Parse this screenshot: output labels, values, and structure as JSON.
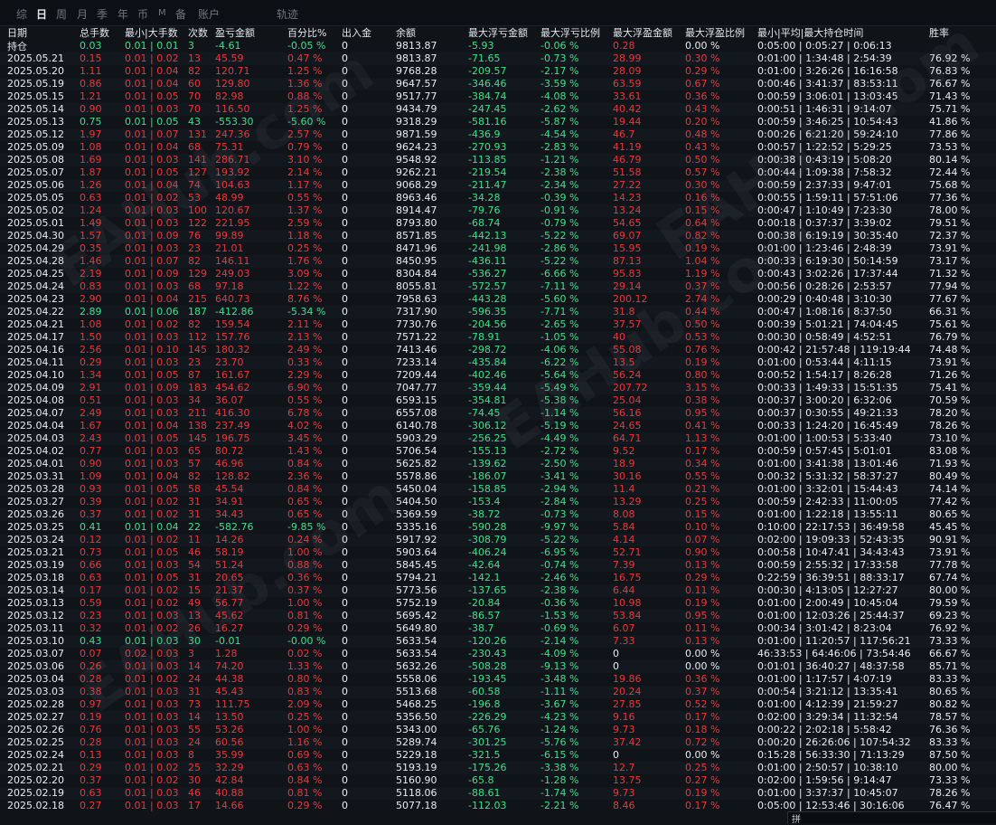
{
  "tabs": [
    {
      "label": "综",
      "active": false
    },
    {
      "label": "日",
      "active": true
    },
    {
      "label": "周",
      "active": false
    },
    {
      "label": "月",
      "active": false
    },
    {
      "label": "季",
      "active": false
    },
    {
      "label": "年",
      "active": false
    },
    {
      "label": "币",
      "active": false
    },
    {
      "label": "M",
      "active": false
    },
    {
      "label": "备",
      "active": false
    },
    {
      "label": "账户",
      "active": false
    },
    {
      "label": "轨迹",
      "active": false
    }
  ],
  "watermark": "EAHub.com",
  "status_glyph": "拼",
  "colors": {
    "positive": "#3ee08a",
    "negative": "#e8383d",
    "neutral": "#e8ebef",
    "background": "#101419"
  },
  "headers": [
    "日期",
    "总手数",
    "最小|大手数",
    "次数",
    "盈亏金额",
    "百分比%",
    "出入金",
    "余额",
    "最大浮亏金额",
    "最大浮亏比例",
    "最大浮盈金额",
    "最大浮盈比例",
    "最小|平均|最大持仓时间",
    "胜率"
  ],
  "header_sub": "持仓",
  "rows": [
    [
      "",
      "0.03",
      "0.01 | 0.01",
      "3",
      "-4.61",
      "-0.05 %",
      "0",
      "9813.87",
      "-5.93",
      "-0.06 %",
      "0.28",
      "0.00 %",
      "0:05:00 | 0:05:27 | 0:06:13",
      ""
    ],
    [
      "2025.05.21",
      "0.15",
      "0.01 | 0.02",
      "13",
      "45.59",
      "0.47 %",
      "0",
      "9813.87",
      "-71.65",
      "-0.73 %",
      "28.99",
      "0.30 %",
      "0:01:00 | 1:34:48 | 2:54:39",
      "76.92 %"
    ],
    [
      "2025.05.20",
      "1.11",
      "0.01 | 0.04",
      "82",
      "120.71",
      "1.25 %",
      "0",
      "9768.28",
      "-209.57",
      "-2.17 %",
      "28.09",
      "0.29 %",
      "0:01:00 | 3:26:26 | 16:16:58",
      "76.83 %"
    ],
    [
      "2025.05.19",
      "0.86",
      "0.01 | 0.04",
      "60",
      "129.80",
      "1.36 %",
      "0",
      "9647.57",
      "-346.46",
      "-3.59 %",
      "63.59",
      "0.67 %",
      "0:00:46 | 3:41:37 | 83:53:11",
      "76.67 %"
    ],
    [
      "2025.05.15",
      "1.21",
      "0.01 | 0.05",
      "70",
      "82.98",
      "0.88 %",
      "0",
      "9517.77",
      "-384.74",
      "-4.08 %",
      "33.61",
      "0.36 %",
      "0:00:59 | 3:06:01 | 13:03:45",
      "71.43 %"
    ],
    [
      "2025.05.14",
      "0.90",
      "0.01 | 0.03",
      "70",
      "116.50",
      "1.25 %",
      "0",
      "9434.79",
      "-247.45",
      "-2.62 %",
      "40.42",
      "0.43 %",
      "0:00:51 | 1:46:31 | 9:14:07",
      "75.71 %"
    ],
    [
      "2025.05.13",
      "0.75",
      "0.01 | 0.05",
      "43",
      "-553.30",
      "-5.60 %",
      "0",
      "9318.29",
      "-581.16",
      "-5.87 %",
      "19.44",
      "0.20 %",
      "0:00:59 | 3:46:25 | 10:54:43",
      "41.86 %"
    ],
    [
      "2025.05.12",
      "1.97",
      "0.01 | 0.07",
      "131",
      "247.36",
      "2.57 %",
      "0",
      "9871.59",
      "-436.9",
      "-4.54 %",
      "46.7",
      "0.48 %",
      "0:00:26 | 6:21:20 | 59:24:10",
      "77.86 %"
    ],
    [
      "2025.05.09",
      "1.08",
      "0.01 | 0.04",
      "68",
      "75.31",
      "0.79 %",
      "0",
      "9624.23",
      "-270.93",
      "-2.83 %",
      "41.19",
      "0.43 %",
      "0:00:57 | 1:22:52 | 5:29:25",
      "73.53 %"
    ],
    [
      "2025.05.08",
      "1.69",
      "0.01 | 0.03",
      "141",
      "286.71",
      "3.10 %",
      "0",
      "9548.92",
      "-113.85",
      "-1.21 %",
      "46.79",
      "0.50 %",
      "0:00:38 | 0:43:19 | 5:08:20",
      "80.14 %"
    ],
    [
      "2025.05.07",
      "1.87",
      "0.01 | 0.05",
      "127",
      "193.92",
      "2.14 %",
      "0",
      "9262.21",
      "-219.54",
      "-2.38 %",
      "51.58",
      "0.57 %",
      "0:00:44 | 1:09:38 | 7:58:32",
      "72.44 %"
    ],
    [
      "2025.05.06",
      "1.26",
      "0.01 | 0.04",
      "74",
      "104.63",
      "1.17 %",
      "0",
      "9068.29",
      "-211.47",
      "-2.34 %",
      "27.22",
      "0.30 %",
      "0:00:59 | 2:37:33 | 9:47:01",
      "75.68 %"
    ],
    [
      "2025.05.05",
      "0.63",
      "0.01 | 0.02",
      "53",
      "48.99",
      "0.55 %",
      "0",
      "8963.46",
      "-34.28",
      "-0.39 %",
      "14.23",
      "0.16 %",
      "0:00:55 | 1:59:11 | 57:51:06",
      "77.36 %"
    ],
    [
      "2025.05.02",
      "1.24",
      "0.01 | 0.03",
      "100",
      "120.67",
      "1.37 %",
      "0",
      "8914.47",
      "-79.76",
      "-0.91 %",
      "13.24",
      "0.15 %",
      "0:00:47 | 1:10:49 | 7:23:30",
      "78.00 %"
    ],
    [
      "2025.05.01",
      "1.49",
      "0.01 | 0.03",
      "122",
      "221.95",
      "2.59 %",
      "0",
      "8793.80",
      "-68.74",
      "-0.79 %",
      "54.65",
      "0.64 %",
      "0:00:18 | 0:37:37 | 3:39:02",
      "79.51 %"
    ],
    [
      "2025.04.30",
      "1.57",
      "0.01 | 0.09",
      "76",
      "99.89",
      "1.18 %",
      "0",
      "8571.85",
      "-442.13",
      "-5.22 %",
      "69.07",
      "0.82 %",
      "0:00:38 | 6:19:19 | 30:35:40",
      "72.37 %"
    ],
    [
      "2025.04.29",
      "0.35",
      "0.01 | 0.03",
      "23",
      "21.01",
      "0.25 %",
      "0",
      "8471.96",
      "-241.98",
      "-2.86 %",
      "15.95",
      "0.19 %",
      "0:01:00 | 1:23:46 | 2:48:39",
      "73.91 %"
    ],
    [
      "2025.04.28",
      "1.46",
      "0.01 | 0.07",
      "82",
      "146.11",
      "1.76 %",
      "0",
      "8450.95",
      "-436.11",
      "-5.22 %",
      "87.13",
      "1.04 %",
      "0:00:33 | 6:19:30 | 50:14:59",
      "73.17 %"
    ],
    [
      "2025.04.25",
      "2.19",
      "0.01 | 0.09",
      "129",
      "249.03",
      "3.09 %",
      "0",
      "8304.84",
      "-536.27",
      "-6.66 %",
      "95.83",
      "1.19 %",
      "0:00:43 | 3:02:26 | 17:37:44",
      "71.32 %"
    ],
    [
      "2025.04.24",
      "0.83",
      "0.01 | 0.03",
      "68",
      "97.18",
      "1.22 %",
      "0",
      "8055.81",
      "-572.57",
      "-7.11 %",
      "29.14",
      "0.37 %",
      "0:00:56 | 0:28:26 | 2:53:57",
      "77.94 %"
    ],
    [
      "2025.04.23",
      "2.90",
      "0.01 | 0.04",
      "215",
      "640.73",
      "8.76 %",
      "0",
      "7958.63",
      "-443.28",
      "-5.60 %",
      "200.12",
      "2.74 %",
      "0:00:29 | 0:40:48 | 3:10:30",
      "77.67 %"
    ],
    [
      "2025.04.22",
      "2.89",
      "0.01 | 0.06",
      "187",
      "-412.86",
      "-5.34 %",
      "0",
      "7317.90",
      "-596.35",
      "-7.71 %",
      "31.8",
      "0.44 %",
      "0:00:47 | 1:08:16 | 8:37:50",
      "66.31 %"
    ],
    [
      "2025.04.21",
      "1.08",
      "0.01 | 0.02",
      "82",
      "159.54",
      "2.11 %",
      "0",
      "7730.76",
      "-204.56",
      "-2.65 %",
      "37.57",
      "0.50 %",
      "0:00:39 | 5:01:21 | 74:04:45",
      "75.61 %"
    ],
    [
      "2025.04.17",
      "1.50",
      "0.01 | 0.03",
      "112",
      "157.76",
      "2.13 %",
      "0",
      "7571.22",
      "-78.91",
      "-1.05 %",
      "40",
      "0.53 %",
      "0:00:30 | 0:58:49 | 4:52:51",
      "76.79 %"
    ],
    [
      "2025.04.16",
      "2.56",
      "0.01 | 0.10",
      "145",
      "180.32",
      "2.49 %",
      "0",
      "7413.46",
      "-298.72",
      "-4.06 %",
      "55.08",
      "0.76 %",
      "0:00:42 | 21:57:48 | 119:19:44",
      "74.48 %"
    ],
    [
      "2025.04.11",
      "0.29",
      "0.01 | 0.03",
      "23",
      "23.70",
      "0.33 %",
      "0",
      "7233.14",
      "-435.84",
      "-6.22 %",
      "13.5",
      "0.19 %",
      "0:01:00 | 0:53:44 | 4:11:15",
      "73.91 %"
    ],
    [
      "2025.04.10",
      "1.34",
      "0.01 | 0.05",
      "87",
      "161.67",
      "2.29 %",
      "0",
      "7209.44",
      "-402.46",
      "-5.64 %",
      "56.24",
      "0.80 %",
      "0:00:52 | 1:54:17 | 8:26:28",
      "71.26 %"
    ],
    [
      "2025.04.09",
      "2.91",
      "0.01 | 0.09",
      "183",
      "454.62",
      "6.90 %",
      "0",
      "7047.77",
      "-359.44",
      "-5.49 %",
      "207.72",
      "3.15 %",
      "0:00:33 | 1:49:33 | 15:51:35",
      "75.41 %"
    ],
    [
      "2025.04.08",
      "0.51",
      "0.01 | 0.03",
      "34",
      "36.07",
      "0.55 %",
      "0",
      "6593.15",
      "-354.81",
      "-5.38 %",
      "25.04",
      "0.38 %",
      "0:00:37 | 3:00:20 | 6:32:06",
      "70.59 %"
    ],
    [
      "2025.04.07",
      "2.49",
      "0.01 | 0.03",
      "211",
      "416.30",
      "6.78 %",
      "0",
      "6557.08",
      "-74.45",
      "-1.14 %",
      "56.16",
      "0.95 %",
      "0:00:37 | 0:30:55 | 49:21:33",
      "78.20 %"
    ],
    [
      "2025.04.04",
      "1.67",
      "0.01 | 0.04",
      "138",
      "237.49",
      "4.02 %",
      "0",
      "6140.78",
      "-306.12",
      "-5.19 %",
      "24.65",
      "0.41 %",
      "0:00:33 | 1:24:20 | 16:45:49",
      "78.26 %"
    ],
    [
      "2025.04.03",
      "2.43",
      "0.01 | 0.05",
      "145",
      "196.75",
      "3.45 %",
      "0",
      "5903.29",
      "-256.25",
      "-4.49 %",
      "64.71",
      "1.13 %",
      "0:01:00 | 1:00:53 | 5:33:40",
      "73.10 %"
    ],
    [
      "2025.04.02",
      "0.77",
      "0.01 | 0.03",
      "65",
      "80.72",
      "1.43 %",
      "0",
      "5706.54",
      "-155.13",
      "-2.72 %",
      "9.52",
      "0.17 %",
      "0:00:59 | 0:57:45 | 5:01:01",
      "83.08 %"
    ],
    [
      "2025.04.01",
      "0.90",
      "0.01 | 0.03",
      "57",
      "46.96",
      "0.84 %",
      "0",
      "5625.82",
      "-139.62",
      "-2.50 %",
      "18.9",
      "0.34 %",
      "0:01:00 | 3:41:38 | 13:01:46",
      "71.93 %"
    ],
    [
      "2025.03.31",
      "1.09",
      "0.01 | 0.04",
      "82",
      "128.82",
      "2.36 %",
      "0",
      "5578.86",
      "-186.07",
      "-3.41 %",
      "30.16",
      "0.55 %",
      "0:00:32 | 5:31:32 | 58:37:27",
      "80.49 %"
    ],
    [
      "2025.03.28",
      "0.93",
      "0.01 | 0.05",
      "58",
      "45.54",
      "0.84 %",
      "0",
      "5450.04",
      "-158.85",
      "-2.94 %",
      "11.4",
      "0.21 %",
      "0:01:00 | 3:32:01 | 15:44:43",
      "74.14 %"
    ],
    [
      "2025.03.27",
      "0.39",
      "0.01 | 0.02",
      "31",
      "34.91",
      "0.65 %",
      "0",
      "5404.50",
      "-153.4",
      "-2.84 %",
      "13.29",
      "0.25 %",
      "0:00:59 | 2:42:33 | 11:00:05",
      "77.42 %"
    ],
    [
      "2025.03.26",
      "0.37",
      "0.01 | 0.02",
      "31",
      "34.43",
      "0.65 %",
      "0",
      "5369.59",
      "-38.72",
      "-0.73 %",
      "8.08",
      "0.15 %",
      "0:01:00 | 1:22:18 | 13:55:11",
      "80.65 %"
    ],
    [
      "2025.03.25",
      "0.41",
      "0.01 | 0.04",
      "22",
      "-582.76",
      "-9.85 %",
      "0",
      "5335.16",
      "-590.28",
      "-9.97 %",
      "5.84",
      "0.10 %",
      "0:10:00 | 22:17:53 | 36:49:58",
      "45.45 %"
    ],
    [
      "2025.03.24",
      "0.12",
      "0.01 | 0.02",
      "11",
      "14.26",
      "0.24 %",
      "0",
      "5917.92",
      "-308.79",
      "-5.22 %",
      "4.14",
      "0.07 %",
      "0:02:00 | 19:09:33 | 52:43:35",
      "90.91 %"
    ],
    [
      "2025.03.21",
      "0.73",
      "0.01 | 0.05",
      "46",
      "58.19",
      "1.00 %",
      "0",
      "5903.64",
      "-406.24",
      "-6.95 %",
      "52.71",
      "0.90 %",
      "0:00:58 | 10:47:41 | 34:43:43",
      "73.91 %"
    ],
    [
      "2025.03.19",
      "0.66",
      "0.01 | 0.03",
      "54",
      "51.24",
      "0.88 %",
      "0",
      "5845.45",
      "-42.64",
      "-0.74 %",
      "7.39",
      "0.13 %",
      "0:00:59 | 2:55:32 | 17:33:58",
      "77.78 %"
    ],
    [
      "2025.03.18",
      "0.63",
      "0.01 | 0.05",
      "31",
      "20.65",
      "0.36 %",
      "0",
      "5794.21",
      "-142.1",
      "-2.46 %",
      "16.75",
      "0.29 %",
      "0:22:59 | 36:39:51 | 88:33:17",
      "67.74 %"
    ],
    [
      "2025.03.14",
      "0.17",
      "0.01 | 0.02",
      "15",
      "21.37",
      "0.37 %",
      "0",
      "5773.56",
      "-137.65",
      "-2.38 %",
      "6.44",
      "0.11 %",
      "0:00:30 | 4:13:05 | 12:27:27",
      "80.00 %"
    ],
    [
      "2025.03.13",
      "0.59",
      "0.01 | 0.02",
      "49",
      "56.77",
      "1.00 %",
      "0",
      "5752.19",
      "-20.84",
      "-0.36 %",
      "10.98",
      "0.19 %",
      "0:01:00 | 2:00:49 | 10:45:04",
      "79.59 %"
    ],
    [
      "2025.03.12",
      "0.23",
      "0.01 | 0.03",
      "13",
      "45.62",
      "0.81 %",
      "0",
      "5695.42",
      "-86.57",
      "-1.53 %",
      "53.84",
      "0.95 %",
      "0:01:00 | 12:03:26 | 25:44:37",
      "69.23 %"
    ],
    [
      "2025.03.11",
      "0.32",
      "0.01 | 0.02",
      "26",
      "16.27",
      "0.29 %",
      "0",
      "5649.80",
      "-38.7",
      "-0.69 %",
      "6.07",
      "0.11 %",
      "0:00:34 | 3:01:42 | 8:23:04",
      "76.92 %"
    ],
    [
      "2025.03.10",
      "0.43",
      "0.01 | 0.03",
      "30",
      "-0.01",
      "-0.00 %",
      "0",
      "5633.54",
      "-120.26",
      "-2.14 %",
      "7.33",
      "0.13 %",
      "0:01:00 | 11:20:57 | 117:56:21",
      "73.33 %"
    ],
    [
      "2025.03.07",
      "0.07",
      "0.02 | 0.03",
      "3",
      "1.28",
      "0.02 %",
      "0",
      "5633.54",
      "-230.43",
      "-4.09 %",
      "0",
      "0.00 %",
      "46:33:53 | 64:46:06 | 73:54:46",
      "66.67 %"
    ],
    [
      "2025.03.06",
      "0.26",
      "0.01 | 0.03",
      "14",
      "74.20",
      "1.33 %",
      "0",
      "5632.26",
      "-508.28",
      "-9.13 %",
      "0",
      "0.00 %",
      "0:01:01 | 36:40:27 | 48:37:58",
      "85.71 %"
    ],
    [
      "2025.03.04",
      "0.28",
      "0.01 | 0.02",
      "24",
      "44.38",
      "0.80 %",
      "0",
      "5558.06",
      "-193.45",
      "-3.48 %",
      "19.86",
      "0.36 %",
      "0:01:00 | 1:17:57 | 4:07:19",
      "83.33 %"
    ],
    [
      "2025.03.03",
      "0.38",
      "0.01 | 0.03",
      "31",
      "45.43",
      "0.83 %",
      "0",
      "5513.68",
      "-60.58",
      "-1.11 %",
      "20.24",
      "0.37 %",
      "0:00:54 | 3:21:12 | 13:35:41",
      "80.65 %"
    ],
    [
      "2025.02.28",
      "0.97",
      "0.01 | 0.03",
      "73",
      "111.75",
      "2.09 %",
      "0",
      "5468.25",
      "-196.8",
      "-3.67 %",
      "27.85",
      "0.52 %",
      "0:01:00 | 4:12:39 | 21:59:27",
      "80.82 %"
    ],
    [
      "2025.02.27",
      "0.19",
      "0.01 | 0.03",
      "14",
      "13.50",
      "0.25 %",
      "0",
      "5356.50",
      "-226.29",
      "-4.23 %",
      "9.16",
      "0.17 %",
      "0:02:00 | 3:29:34 | 11:32:54",
      "78.57 %"
    ],
    [
      "2025.02.26",
      "0.76",
      "0.01 | 0.03",
      "55",
      "53.26",
      "1.00 %",
      "0",
      "5343.00",
      "-65.76",
      "-1.24 %",
      "9.73",
      "0.18 %",
      "0:00:22 | 2:02:18 | 5:58:42",
      "76.36 %"
    ],
    [
      "2025.02.25",
      "0.28",
      "0.01 | 0.03",
      "24",
      "60.56",
      "1.16 %",
      "0",
      "5289.74",
      "-301.25",
      "-5.76 %",
      "37.42",
      "0.72 %",
      "0:00:20 | 26:26:06 | 107:54:32",
      "83.33 %"
    ],
    [
      "2025.02.24",
      "0.13",
      "0.01 | 0.03",
      "8",
      "35.99",
      "0.69 %",
      "0",
      "5229.18",
      "-321.5",
      "-6.15 %",
      "0",
      "0.00 %",
      "0:15:28 | 56:33:30 | 71:13:29",
      "87.50 %"
    ],
    [
      "2025.02.21",
      "0.29",
      "0.01 | 0.02",
      "25",
      "32.29",
      "0.63 %",
      "0",
      "5193.19",
      "-175.26",
      "-3.38 %",
      "12.7",
      "0.25 %",
      "0:01:00 | 2:50:57 | 10:38:10",
      "80.00 %"
    ],
    [
      "2025.02.20",
      "0.37",
      "0.01 | 0.02",
      "30",
      "42.84",
      "0.84 %",
      "0",
      "5160.90",
      "-65.8",
      "-1.28 %",
      "13.75",
      "0.27 %",
      "0:02:00 | 1:59:56 | 9:14:47",
      "73.33 %"
    ],
    [
      "2025.02.19",
      "0.63",
      "0.01 | 0.03",
      "46",
      "40.88",
      "0.81 %",
      "0",
      "5118.06",
      "-88.61",
      "-1.74 %",
      "9.73",
      "0.19 %",
      "0:01:00 | 3:37:37 | 10:45:07",
      "78.26 %"
    ],
    [
      "2025.02.18",
      "0.27",
      "0.01 | 0.03",
      "17",
      "14.66",
      "0.29 %",
      "0",
      "5077.18",
      "-112.03",
      "-2.21 %",
      "8.46",
      "0.17 %",
      "0:05:00 | 12:53:46 | 30:16:06",
      "76.47 %"
    ]
  ]
}
